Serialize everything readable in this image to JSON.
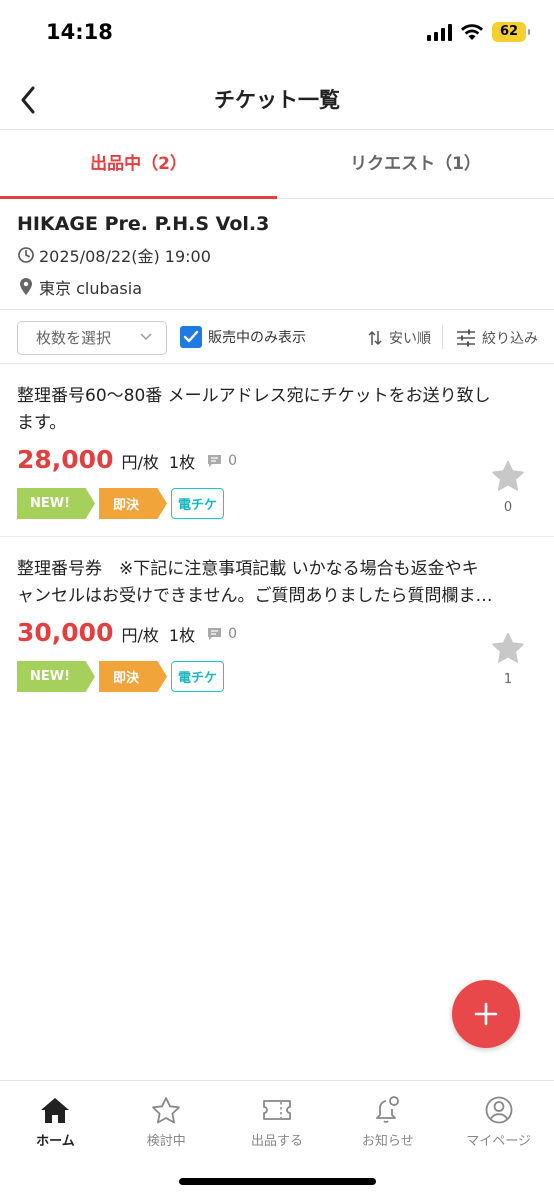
{
  "status_bar": {
    "time": "14:18",
    "battery": "62"
  },
  "header": {
    "title": "チケット一覧"
  },
  "tabs": [
    {
      "label": "出品中（2）",
      "active": true
    },
    {
      "label": "リクエスト（1）",
      "active": false
    }
  ],
  "event": {
    "title": "HIKAGE Pre. P.H.S Vol.3",
    "datetime": "2025/08/22(金) 19:00",
    "venue": "東京 clubasia"
  },
  "filters": {
    "quantity_placeholder": "枚数を選択",
    "onsale_only_label": "販売中のみ表示",
    "onsale_only_checked": true,
    "sort_label": "安い順",
    "filter_label": "絞り込み"
  },
  "listings": [
    {
      "description_line1": "整理番号60〜80番 メールアドレス宛にチケットをお送り致し",
      "description_line2": "ます。",
      "price": "28,000",
      "unit": "円/枚",
      "qty": "1枚",
      "comments": "0",
      "badges": {
        "new": "NEW!",
        "instant": "即決",
        "eticket": "電チケ"
      },
      "favorites": "0"
    },
    {
      "description_line1": "整理番号券　※下記に注意事項記載 いかなる場合も返金やキ",
      "description_line2": "ャンセルはお受けできません。ご質問ありましたら質問欄ま…",
      "price": "30,000",
      "unit": "円/枚",
      "qty": "1枚",
      "comments": "0",
      "badges": {
        "new": "NEW!",
        "instant": "即決",
        "eticket": "電チケ"
      },
      "favorites": "1"
    }
  ],
  "bottom_nav": [
    {
      "label": "ホーム",
      "icon": "home-icon",
      "active": true
    },
    {
      "label": "検討中",
      "icon": "star-icon",
      "active": false
    },
    {
      "label": "出品する",
      "icon": "ticket-icon",
      "active": false
    },
    {
      "label": "お知らせ",
      "icon": "bell-icon",
      "active": false
    },
    {
      "label": "マイページ",
      "icon": "user-icon",
      "active": false
    }
  ],
  "colors": {
    "accent": "#e2403f",
    "checkbox": "#1e7be6",
    "new_badge": "#a5d05b",
    "instant_badge": "#f0a43a",
    "eticket_badge": "#22c4cc"
  }
}
